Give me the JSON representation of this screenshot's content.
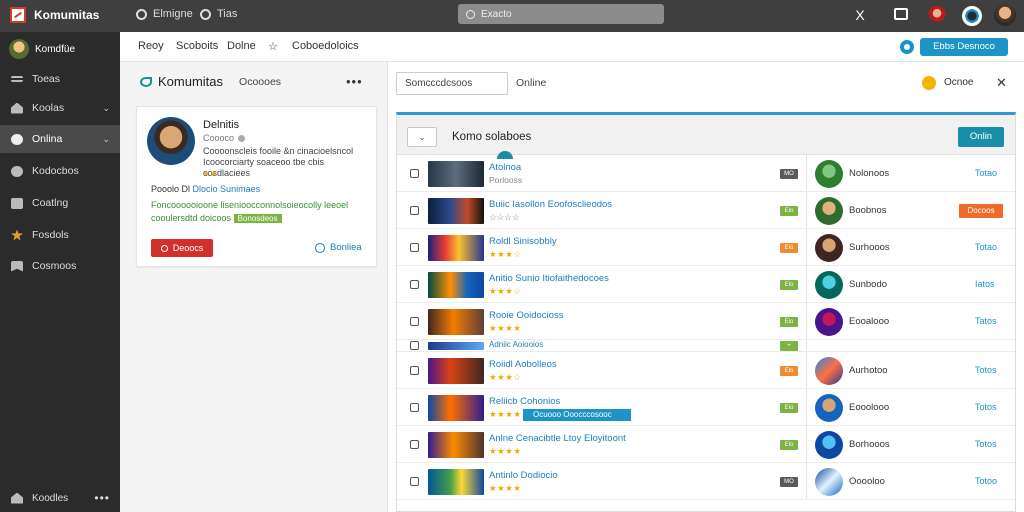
{
  "app": {
    "brand": "Komumitas",
    "nav": [
      {
        "label": "Elmigne",
        "icon": "compass-icon"
      },
      {
        "label": "Tias",
        "icon": "globe-icon"
      }
    ],
    "search_placeholder": "Exacto",
    "close_glyph": "X"
  },
  "sidebar": {
    "user": "Komdfüe",
    "items": [
      {
        "label": "Toeas",
        "icon": "scale-icon",
        "chevron": ""
      },
      {
        "label": "Koolas",
        "icon": "home-icon",
        "chevron": "⌄"
      },
      {
        "label": "Onlina",
        "icon": "clock-icon",
        "chevron": "⌄",
        "active": true
      },
      {
        "label": "Kodocbos",
        "icon": "chat-icon",
        "chevron": ""
      },
      {
        "label": "Coatlng",
        "icon": "folder-icon",
        "chevron": ""
      },
      {
        "label": "Fosdols",
        "icon": "star-icon",
        "chevron": ""
      },
      {
        "label": "Cosmoos",
        "icon": "bookmark-icon",
        "chevron": ""
      }
    ],
    "footer": "Koodles",
    "footer_more": "•••"
  },
  "subbar": {
    "tabs": [
      "Reoy",
      "Scoboits",
      "Dolne",
      "☆",
      "Coboedoloics"
    ],
    "primary_button": "Ebbs Desnoco"
  },
  "left": {
    "title": "Komumitas",
    "subtitle": "Ocoooes",
    "more": "•••",
    "card": {
      "name": "Delnitis",
      "role": "Coooco",
      "bio": "Coooonscleis fooile &n cinacioelsncol Icoocorciarty soaceoo tbe cbis cosdlaciees",
      "stars": "★★",
      "line1_prefix": "Pooolo Dl",
      "line1_link": "Dlocio Sunimaes",
      "line2_text": "Foncoooooioone lisenioocconnolsoieocolly leeoel cooulersdtd doicoos",
      "line2_tag": "Bonosdeos",
      "danger_button": "Deoocs",
      "link_button": "Bonliea"
    }
  },
  "main": {
    "filter_field": "Somcccdcsoos",
    "filter_label": "Online",
    "status_label": "Ocnoe",
    "close": "✕",
    "panel_title": "Komo solaboes",
    "panel_dropdown": "⌄",
    "panel_button": "Onlin",
    "rows": [
      {
        "title": "Atolnoa",
        "sub": "Porlooss",
        "sub_gray": true,
        "chip": "MO",
        "chip_color": "#5a5a5a",
        "thumb": "linear-gradient(90deg,#273746,#5d6d7e 50%,#1c2833)",
        "avatar": "radial-gradient(circle at 50% 40%,#7fc97f 0 30%,#2e7d32 31%)",
        "person": "Nolonoos",
        "action": "Totao",
        "action_button": false
      },
      {
        "title": "Buiic Iasollon Eoofosclieodos",
        "sub": "☆☆☆☆",
        "sub_gray": true,
        "chip": "Elo",
        "chip_color": "#7cb342",
        "thumb": "linear-gradient(90deg,#0b1f3a,#2e4a8a 40%,#c44a2a 70%,#111)",
        "avatar": "radial-gradient(circle at 50% 40%,#e0b080 0 30%,#2f6b2f 31%)",
        "person": "Boobnos",
        "action": "Docoos",
        "action_button": true
      },
      {
        "title": "Roldl Sinisobbly",
        "sub": "★★★☆",
        "sub_gray": false,
        "chip": "Elo",
        "chip_color": "#ef8a30",
        "thumb": "linear-gradient(90deg,#1a237e,#e53935 30%,#fbc02d 55%,#283593)",
        "avatar": "radial-gradient(circle at 50% 40%,#d7a477 0 30%,#3e2723 31%)",
        "person": "Surhooos",
        "action": "Totao",
        "action_button": false
      },
      {
        "title": "Anitio Sunio Itiofaithedocoes",
        "sub": "★★★☆",
        "sub_gray": false,
        "chip": "Elo",
        "chip_color": "#7cb342",
        "thumb": "linear-gradient(90deg,#004d40,#ff8f00 40%,#1565c0 70%,#0d47a1)",
        "avatar": "radial-gradient(circle at 50% 40%,#4dd0e1 0 30%,#00695c 31%)",
        "person": "Sunbodo",
        "action": "Iatos",
        "action_button": false
      },
      {
        "title": "Rooie Ooidocioss",
        "sub": "★★★★",
        "sub_gray": false,
        "chip": "Elo",
        "chip_color": "#7cb342",
        "thumb": "linear-gradient(90deg,#3e2723,#f57c00 45%,#5d4037)",
        "avatar": "radial-gradient(circle at 50% 40%,#c2185b 0 30%,#4a148c 31%)",
        "person": "Eooalooo",
        "action": "Tatos",
        "action_button": false
      },
      {
        "title": "Adniic Aoiooios",
        "sub": "",
        "sub_gray": false,
        "chip": "+",
        "chip_color": "#7cb342",
        "thumb": "linear-gradient(90deg,#1e3a8a,#60a5fa)",
        "avatar": "",
        "person": "",
        "action": "",
        "action_button": false,
        "short": true
      },
      {
        "title": "Roiidl Aobolleos",
        "sub": "★★★☆",
        "sub_gray": false,
        "chip": "Elo",
        "chip_color": "#ef8a30",
        "thumb": "linear-gradient(90deg,#4a148c,#d84315 40%,#3e2723)",
        "avatar": "linear-gradient(135deg,#1e88e5,#ff7043 50%,#283593)",
        "person": "Aurhotoo",
        "action": "Totos",
        "action_button": false
      },
      {
        "title": "Reliicb Cohonios",
        "sub": "★★★★",
        "sub_gray": false,
        "chip": "Elo",
        "chip_color": "#7cb342",
        "thumb": "linear-gradient(90deg,#0d47a1,#ff6f00 40%,#311b92)",
        "avatar": "radial-gradient(circle at 50% 40%,#d7a477 0 30%,#1565c0 31%)",
        "person": "Eooolooo",
        "action": "Totos",
        "action_button": false,
        "extra_tag": "Ocuooo Ooocccosooc"
      },
      {
        "title": "Anlne Cenacibtle Ltoy Eloyitoont",
        "sub": "★★★★",
        "sub_gray": false,
        "chip": "Elo",
        "chip_color": "#7cb342",
        "thumb": "linear-gradient(90deg,#311b92,#fb8c00 45%,#4e342e)",
        "avatar": "radial-gradient(circle at 50% 40%,#4fc3f7 0 30%,#0d47a1 31%)",
        "person": "Borhooos",
        "action": "Totos",
        "action_button": false
      },
      {
        "title": "Antinlo Dodiocio",
        "sub": "★★★★",
        "sub_gray": false,
        "chip": "MO",
        "chip_color": "#5a5a5a",
        "thumb": "linear-gradient(90deg,#01579b,#43a047 40%,#fdd835 60%,#0d47a1)",
        "avatar": "linear-gradient(135deg,#0d47a1,#e3f2fd 50%,#1565c0)",
        "person": "Ooooloo",
        "action": "Totoo",
        "action_button": false
      }
    ]
  }
}
